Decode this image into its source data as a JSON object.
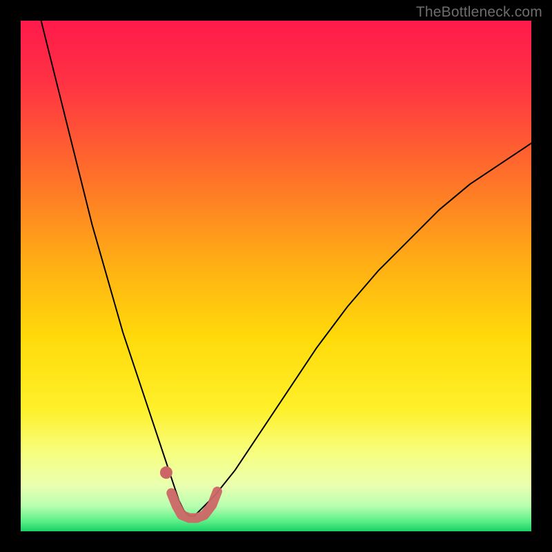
{
  "watermark": "TheBottleneck.com",
  "chart_data": {
    "type": "line",
    "title": "",
    "xlabel": "",
    "ylabel": "",
    "xlim": [
      0,
      100
    ],
    "ylim": [
      0,
      100
    ],
    "background_gradient": {
      "top": "#ff2050",
      "mid1": "#ff7b1e",
      "mid2": "#ffe300",
      "mid3": "#f7ff8a",
      "bottom": "#1bdc62"
    },
    "series": [
      {
        "name": "bottleneck-curve",
        "color": "#000000",
        "width": 2,
        "x": [
          4,
          6,
          8,
          10,
          12,
          14,
          16,
          18,
          20,
          22,
          24,
          26,
          28,
          30,
          31,
          32,
          33,
          34,
          35,
          38,
          42,
          46,
          52,
          58,
          64,
          70,
          76,
          82,
          88,
          94,
          100
        ],
        "y": [
          100,
          92,
          84,
          76,
          68,
          60,
          53,
          46,
          39,
          33,
          27,
          21,
          15,
          9,
          6,
          4,
          3,
          3,
          4,
          7,
          12,
          18,
          27,
          36,
          44,
          51,
          57,
          63,
          68,
          72,
          76
        ]
      },
      {
        "name": "highlight-region",
        "color": "#cc6666",
        "width": 14,
        "opacity": 0.95,
        "x": [
          29.5,
          30.5,
          31.5,
          33,
          34.5,
          36,
          37.5,
          38.5
        ],
        "y": [
          7.5,
          5,
          3.2,
          2.6,
          2.6,
          3.2,
          5.2,
          7.8
        ]
      },
      {
        "name": "highlight-marker",
        "type": "scatter",
        "color": "#cc6666",
        "size": 9,
        "x": [
          28.5
        ],
        "y": [
          11.5
        ]
      }
    ]
  }
}
